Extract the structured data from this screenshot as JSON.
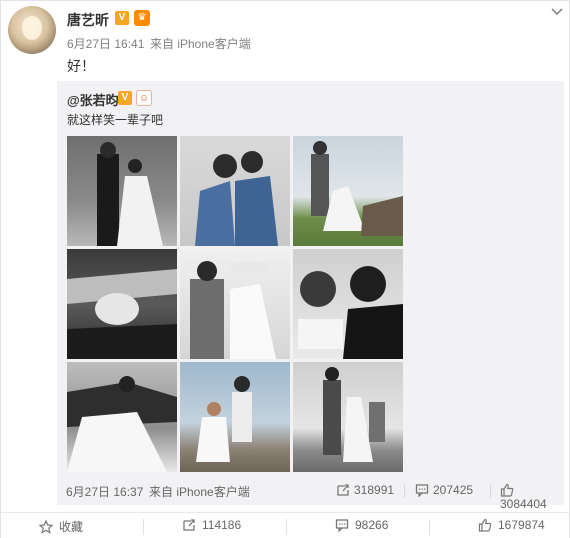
{
  "post": {
    "author": "唐艺昕",
    "timestamp": "6月27日 16:41",
    "source": "来自 iPhone客户端",
    "text": "好！"
  },
  "repost": {
    "author": "@张若昀",
    "text": "就这样笑一辈子吧",
    "timestamp": "6月27日 16:37",
    "source": "来自 iPhone客户端",
    "reposts": "318991",
    "comments": "207425",
    "likes": "3084404"
  },
  "actions": {
    "favorite": "收藏",
    "repost_count": "114186",
    "comment_count": "98266",
    "like_count": "1679874"
  },
  "colors": {
    "link": "#eb7350",
    "verified": "#f5a623",
    "repost_bg": "#f2f2f5"
  }
}
